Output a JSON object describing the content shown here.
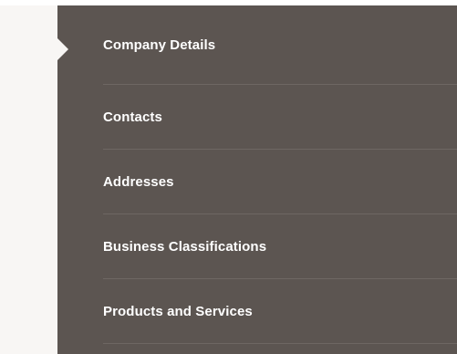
{
  "nav": {
    "items": [
      {
        "label": "Company Details",
        "selected": true
      },
      {
        "label": "Contacts",
        "selected": false
      },
      {
        "label": "Addresses",
        "selected": false
      },
      {
        "label": "Business Classifications",
        "selected": false
      },
      {
        "label": "Products and Services",
        "selected": false
      }
    ]
  },
  "colors": {
    "panel_bg": "#5c5551",
    "left_bg": "#f8f6f4",
    "divider": "#6e6763",
    "text": "#ffffff"
  }
}
